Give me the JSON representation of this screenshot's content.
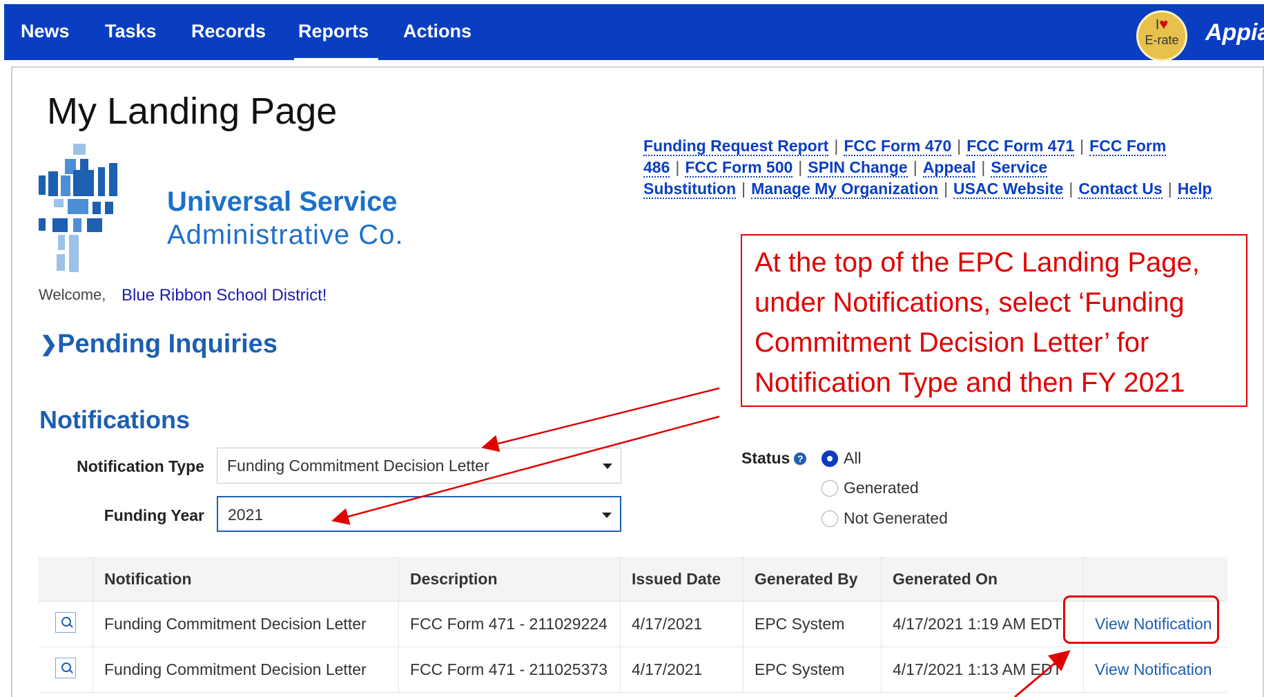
{
  "nav": {
    "items": [
      "News",
      "Tasks",
      "Records",
      "Reports",
      "Actions"
    ],
    "active": "Reports",
    "badge_line1": "I",
    "badge_line2": "E-rate",
    "brand": "Appian"
  },
  "page": {
    "title": "My Landing Page",
    "org_name_line1": "Universal Service",
    "org_name_line2": "Administrative Co.",
    "welcome_label": "Welcome,",
    "welcome_name": "Blue Ribbon School District!",
    "pending_label": "Pending Inquiries"
  },
  "links": [
    "Funding Request Report",
    "FCC Form 470",
    "FCC Form 471",
    "FCC Form 486",
    "FCC Form 500",
    "SPIN Change",
    "Appeal",
    "Service Substitution",
    "Manage My Organization",
    "USAC Website",
    "Contact Us",
    "Help"
  ],
  "callout": {
    "text": "At the top of the EPC  Landing Page, under Notifications, select  ‘Funding Commitment  Decision Letter’ for Notification  Type and then FY 2021"
  },
  "notifications": {
    "heading": "Notifications",
    "type_label": "Notification Type",
    "type_value": "Funding Commitment Decision Letter",
    "year_label": "Funding Year",
    "year_value": "2021",
    "status_label": "Status",
    "status_options": [
      "All",
      "Generated",
      "Not Generated"
    ],
    "status_selected": "All"
  },
  "table": {
    "headers": [
      "",
      "Notification",
      "Description",
      "Issued Date",
      "Generated By",
      "Generated On",
      ""
    ],
    "rows": [
      {
        "notification": "Funding Commitment Decision Letter",
        "description": "FCC Form 471 - 211029224",
        "issued": "4/17/2021",
        "generated_by": "EPC System",
        "generated_on": "4/17/2021 1:19 AM EDT",
        "action": "View Notification"
      },
      {
        "notification": "Funding Commitment Decision Letter",
        "description": "FCC Form 471 - 211025373",
        "issued": "4/17/2021",
        "generated_by": "EPC System",
        "generated_on": "4/17/2021 1:13 AM EDT",
        "action": "View Notification"
      }
    ]
  },
  "colors": {
    "nav_bg": "#0a3ec2",
    "callout_red": "#e00000",
    "heading_blue": "#1d5fb0"
  }
}
